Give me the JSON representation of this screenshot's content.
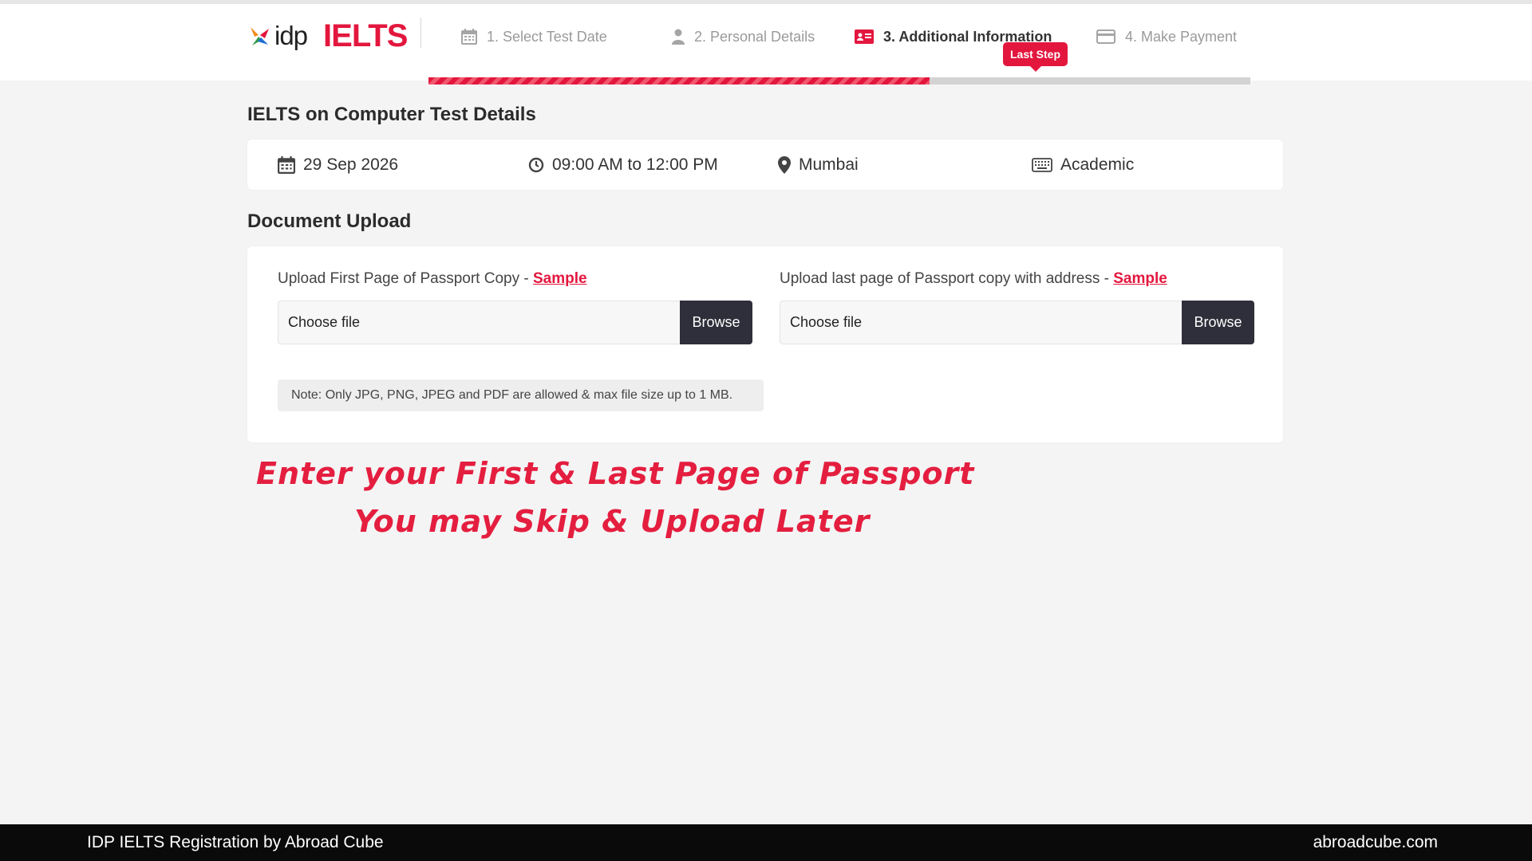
{
  "header": {
    "brand_idp": "idp",
    "brand_ielts": "IELTS",
    "steps": [
      {
        "label": "1. Select Test Date",
        "icon": "calendar-icon",
        "active": false
      },
      {
        "label": "2. Personal Details",
        "icon": "user-icon",
        "active": false
      },
      {
        "label": "3. Additional Information",
        "icon": "id-card-icon",
        "active": true
      },
      {
        "label": "4. Make Payment",
        "icon": "credit-card-icon",
        "active": false
      }
    ],
    "badge": "Last Step",
    "progress_fraction": 0.61,
    "accent_color": "#e3173e"
  },
  "test_details": {
    "title": "IELTS on Computer Test Details",
    "date": "29 Sep 2026",
    "time": "09:00 AM to 12:00 PM",
    "location": "Mumbai",
    "module": "Academic"
  },
  "document_upload": {
    "title": "Document Upload",
    "first": {
      "label": "Upload First Page of Passport Copy - ",
      "sample": "Sample",
      "placeholder": "Choose file",
      "browse": "Browse"
    },
    "last": {
      "label": "Upload last page of Passport copy with address - ",
      "sample": "Sample",
      "placeholder": "Choose file",
      "browse": "Browse"
    },
    "note": "Note: Only JPG, PNG, JPEG and PDF are allowed & max file size up to 1 MB."
  },
  "annotation": {
    "line1": "Enter your First & Last Page of Passport",
    "line2": "You may Skip & Upload Later"
  },
  "footer": {
    "left": "IDP IELTS Registration by Abroad Cube",
    "right": "abroadcube.com"
  }
}
